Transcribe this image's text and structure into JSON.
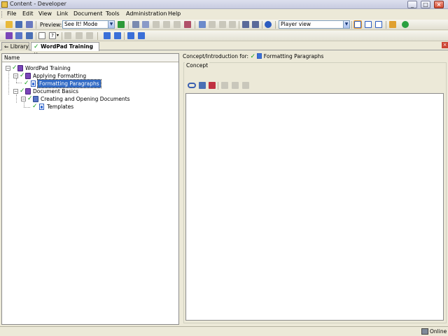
{
  "window": {
    "title": "Content - Developer",
    "buttons": {
      "minimize": "_",
      "maximize": "□",
      "close": "×"
    }
  },
  "menu": [
    "File",
    "Edit",
    "View",
    "Link",
    "Document",
    "Tools",
    "Administration",
    "Help"
  ],
  "toolbar": {
    "preview_label": "Preview:",
    "mode_value": "See It! Mode",
    "view_value": "Player view"
  },
  "tabs": [
    {
      "label": "Library",
      "active": false
    },
    {
      "label": "WordPad Training",
      "active": true
    }
  ],
  "tree": {
    "column_header": "Name",
    "nodes": [
      {
        "label": "WordPad Training",
        "level": 0,
        "type": "book",
        "checked": true,
        "expanded": true
      },
      {
        "label": "Applying Formatting",
        "level": 1,
        "type": "book",
        "checked": true,
        "expanded": true
      },
      {
        "label": "Formatting Paragraphs",
        "level": 2,
        "type": "page",
        "checked": true,
        "selected": true
      },
      {
        "label": "Document Basics",
        "level": 1,
        "type": "book",
        "checked": true,
        "expanded": true
      },
      {
        "label": "Creating and Opening Documents",
        "level": 2,
        "type": "book",
        "checked": true,
        "expanded": true
      },
      {
        "label": "Templates",
        "level": 3,
        "type": "page",
        "checked": true
      }
    ]
  },
  "right": {
    "header_prefix": "Concept/Introduction for:",
    "header_item": "Formatting Paragraphs",
    "group_label": "Concept"
  },
  "status": {
    "text": "Online"
  },
  "colors": {
    "selection": "#316ac5",
    "check": "#15a01a",
    "book": "#7a46b8"
  }
}
